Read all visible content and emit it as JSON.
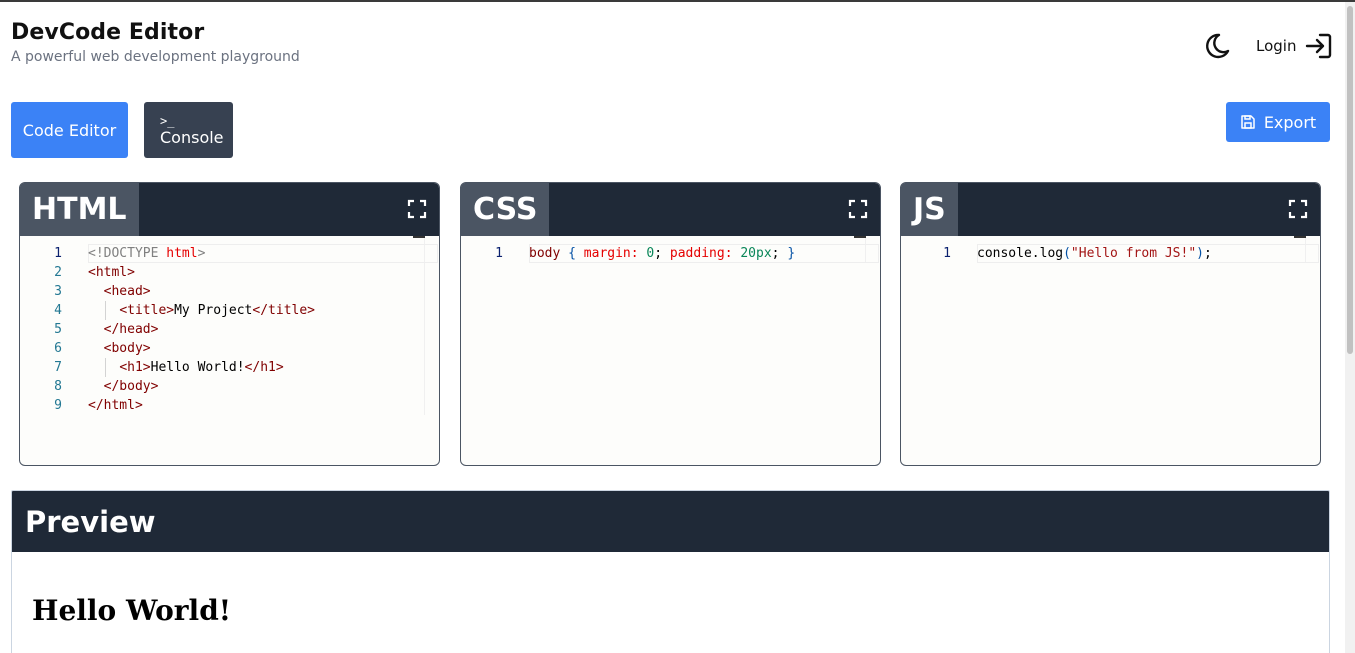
{
  "app": {
    "title": "DevCode Editor",
    "subtitle": "A powerful web development playground"
  },
  "topbar": {
    "theme_icon": "moon-icon",
    "login_label": "Login",
    "login_icon": "login-arrow-icon"
  },
  "tabs": {
    "editor_label": "Code Editor",
    "console_prompt": ">_",
    "console_label": "Console"
  },
  "export": {
    "label": "Export",
    "icon": "save-icon"
  },
  "panels": {
    "html": {
      "label": "HTML"
    },
    "css": {
      "label": "CSS"
    },
    "js": {
      "label": "JS"
    }
  },
  "code": {
    "html": [
      "<!DOCTYPE html>",
      "<html>",
      "  <head>",
      "    <title>My Project</title>",
      "  </head>",
      "  <body>",
      "    <h1>Hello World!</h1>",
      "  </body>",
      "</html>"
    ],
    "css": [
      "body { margin: 0; padding: 20px; }"
    ],
    "js": [
      "console.log(\"Hello from JS!\");"
    ]
  },
  "line_numbers": {
    "html": [
      "1",
      "2",
      "3",
      "4",
      "5",
      "6",
      "7",
      "8",
      "9"
    ],
    "css": [
      "1"
    ],
    "js": [
      "1"
    ]
  },
  "preview": {
    "title": "Preview",
    "heading": "Hello World!"
  },
  "colors": {
    "accent": "#3b82f6",
    "dark_header": "#1f2937",
    "lang_tab": "#4b5563",
    "console_tab": "#374151"
  }
}
